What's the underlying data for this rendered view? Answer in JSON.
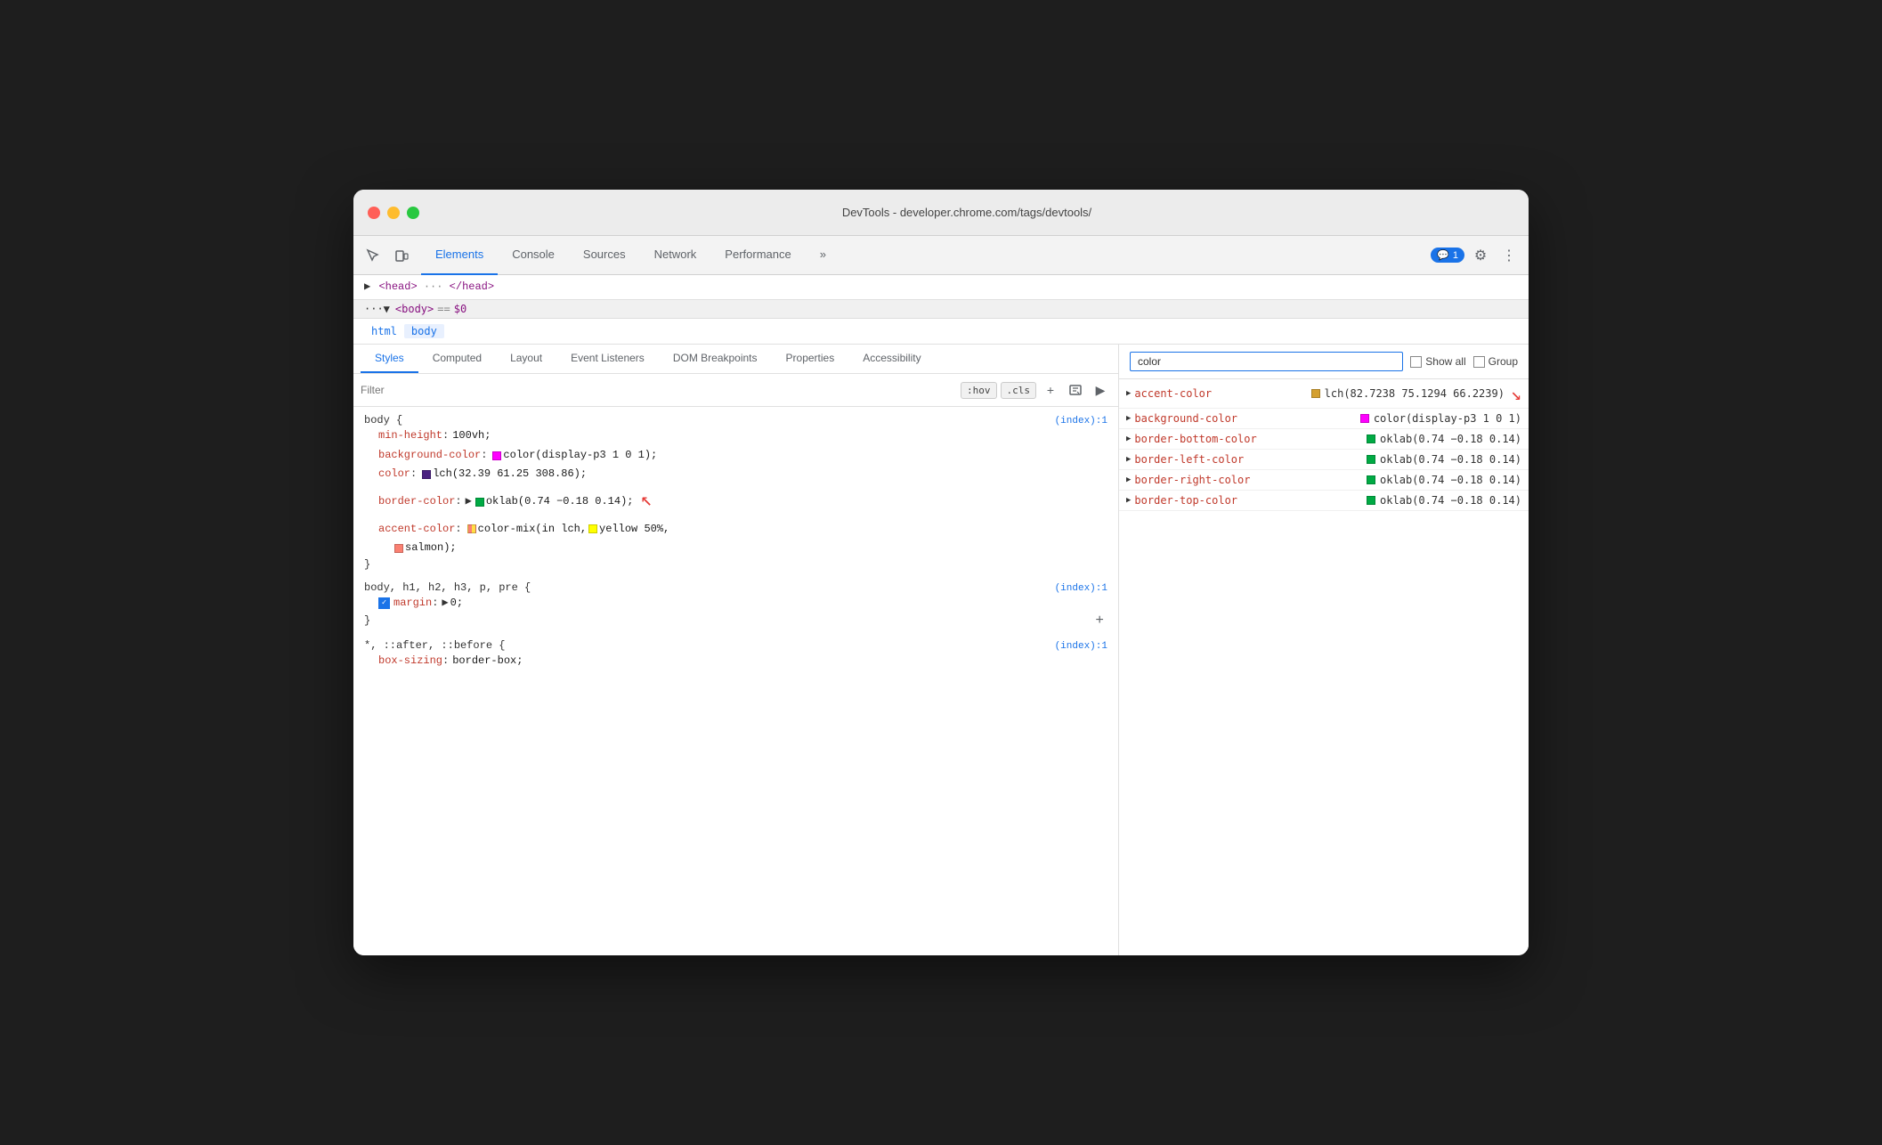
{
  "window": {
    "title": "DevTools - developer.chrome.com/tags/devtools/"
  },
  "toolbar": {
    "tabs": [
      {
        "id": "elements",
        "label": "Elements",
        "active": true
      },
      {
        "id": "console",
        "label": "Console",
        "active": false
      },
      {
        "id": "sources",
        "label": "Sources",
        "active": false
      },
      {
        "id": "network",
        "label": "Network",
        "active": false
      },
      {
        "id": "performance",
        "label": "Performance",
        "active": false
      },
      {
        "id": "more",
        "label": "»",
        "active": false
      }
    ],
    "chat_badge": "1",
    "settings_icon": "⚙",
    "more_icon": "⋮"
  },
  "dom": {
    "head_line": "▶ <head> ··· </head>",
    "body_line": "··· ▼ <body> == $0"
  },
  "breadcrumb": {
    "items": [
      {
        "label": "html",
        "active": false
      },
      {
        "label": "body",
        "active": true
      }
    ]
  },
  "sub_tabs": {
    "items": [
      {
        "label": "Styles",
        "active": true
      },
      {
        "label": "Computed",
        "active": false
      },
      {
        "label": "Layout",
        "active": false
      },
      {
        "label": "Event Listeners",
        "active": false
      },
      {
        "label": "DOM Breakpoints",
        "active": false
      },
      {
        "label": "Properties",
        "active": false
      },
      {
        "label": "Accessibility",
        "active": false
      }
    ]
  },
  "filter": {
    "placeholder": "Filter",
    "hov_label": ":hov",
    "cls_label": ".cls"
  },
  "css_rules": [
    {
      "selector": "body {",
      "source": "(index):1",
      "properties": [
        {
          "name": "min-height",
          "value": "100vh;",
          "swatch": null
        },
        {
          "name": "background-color",
          "value": "color(display-p3 1 0 1);",
          "swatch": "#ff00ff",
          "swatch2": null
        },
        {
          "name": "color",
          "value": "lch(32.39 61.25 308.86);",
          "swatch": "#4a2080",
          "swatch2": null
        },
        {
          "name": "border-color",
          "value": "oklab(0.74 −0.18 0.14);",
          "swatch": "#00aa44",
          "swatch2": null,
          "has_triangle": true
        },
        {
          "name": "accent-color",
          "value": "color-mix(in lch, ",
          "value2": "yellow 50%, ",
          "value3": "salmon);",
          "swatch": "#e8c060",
          "swatch_yellow": "#ffff00",
          "swatch_salmon": "#fa8072",
          "is_mix": true
        }
      ],
      "close": "}"
    },
    {
      "selector": "body, h1, h2, h3, p, pre {",
      "source": "(index):1",
      "properties": [
        {
          "name": "margin",
          "value": "▶ 0;",
          "has_checkbox": true
        }
      ],
      "close": "}",
      "has_add": true
    },
    {
      "selector": "*, ::after, ::before {",
      "source": "(index):1",
      "properties": [
        {
          "name": "box-sizing",
          "value": "border-box;",
          "partial": true
        }
      ]
    }
  ],
  "computed": {
    "search_placeholder": "color",
    "search_value": "color",
    "show_all_label": "Show all",
    "group_label": "Group",
    "items": [
      {
        "name": "accent-color",
        "swatch": "#d4a030",
        "value": "lch(82.7238 75.1294 66.2239)",
        "has_arrow": true
      },
      {
        "name": "background-color",
        "swatch": "#ff00ff",
        "value": "color(display-p3 1 0 1)",
        "has_arrow": false
      },
      {
        "name": "border-bottom-color",
        "swatch": "#00aa44",
        "value": "oklab(0.74 −0.18 0.14)",
        "has_arrow": false
      },
      {
        "name": "border-left-color",
        "swatch": "#00aa44",
        "value": "oklab(0.74 −0.18 0.14)",
        "has_arrow": false
      },
      {
        "name": "border-right-color",
        "swatch": "#00aa44",
        "value": "oklab(0.74 −0.18 0.14)",
        "has_arrow": false
      },
      {
        "name": "border-top-color",
        "swatch": "#00aa44",
        "value": "oklab(0.74 −0.18 0.14)",
        "has_arrow": false
      }
    ]
  }
}
